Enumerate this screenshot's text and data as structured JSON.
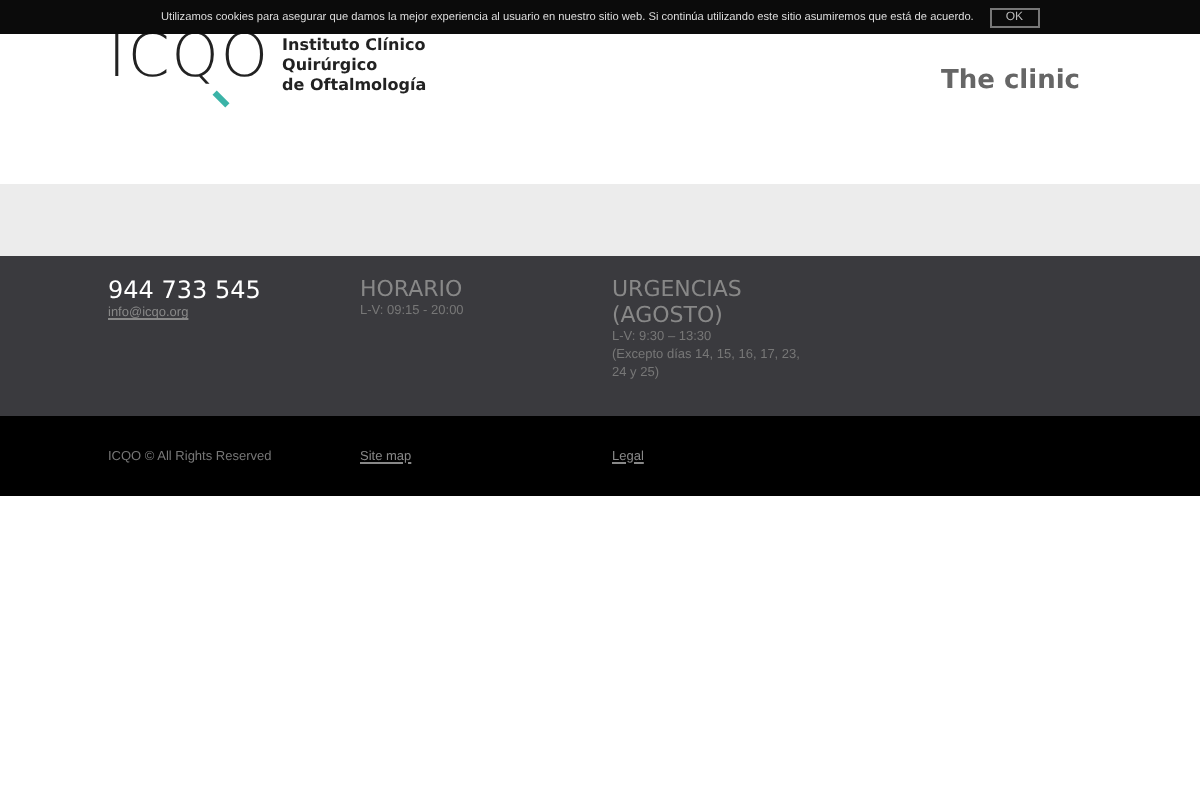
{
  "cookie_bar": {
    "message": "Utilizamos cookies para asegurar que damos la mejor experiencia al usuario en nuestro sitio web. Si continúa utilizando este sitio asumiremos que está de acuerdo.",
    "button": "OK"
  },
  "header": {
    "logo": {
      "mark": "ICQO",
      "lines": [
        "Instituto Clínico",
        "Quirúrgico",
        "de Oftalmología"
      ]
    },
    "nav": [
      {
        "label": "The clinic"
      }
    ]
  },
  "footer": {
    "columns": [
      {
        "kind": "contact",
        "title": "944 733 545",
        "lines": [
          "info@icqo.org"
        ]
      },
      {
        "kind": "info",
        "title": "HORARIO",
        "lines": [
          "L-V: 09:15 - 20:00"
        ]
      },
      {
        "kind": "info",
        "title": "URGENCIAS (AGOSTO)",
        "lines": [
          "L-V: 9:30 – 13:30",
          "(Excepto días 14, 15, 16, 17, 23, 24 y 25)"
        ]
      }
    ]
  },
  "bottom_bar": {
    "copyright": "ICQO © All Rights Reserved",
    "links": [
      "Site map",
      "Legal"
    ]
  }
}
